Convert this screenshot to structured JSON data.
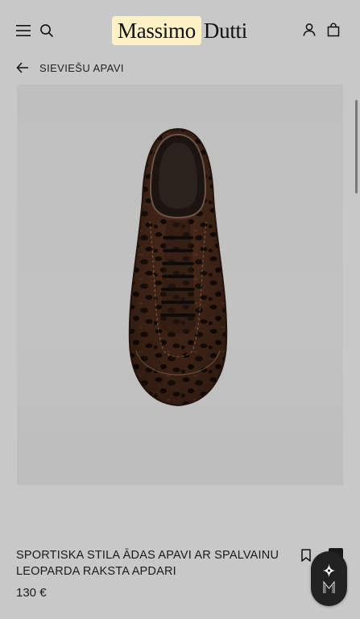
{
  "header": {
    "logo_left": "Massimo",
    "logo_right": "Dutti",
    "logo_highlight_color": "#fdf1c5",
    "icons": [
      "menu-icon",
      "search-icon",
      "user-icon",
      "shopping-bag-icon"
    ]
  },
  "breadcrumb": {
    "label": "SIEVIEŠU APAVI",
    "icon": "arrow-left-icon"
  },
  "product": {
    "title": "SPORTISKA STILA ĀDAS APAVI AR SPALVAINU LEOPARDA RAKSTA APDARI",
    "price": "130 €",
    "image_subject": "brown leopard-print pony hair lace-up sneaker, top view"
  },
  "actions": {
    "bookmark_icon": "bookmark-icon",
    "assistant_icon": "assistant-logo-icon"
  },
  "colors": {
    "background": "#c8c8c8",
    "text": "#1a1a1a",
    "fab": "#222222"
  }
}
